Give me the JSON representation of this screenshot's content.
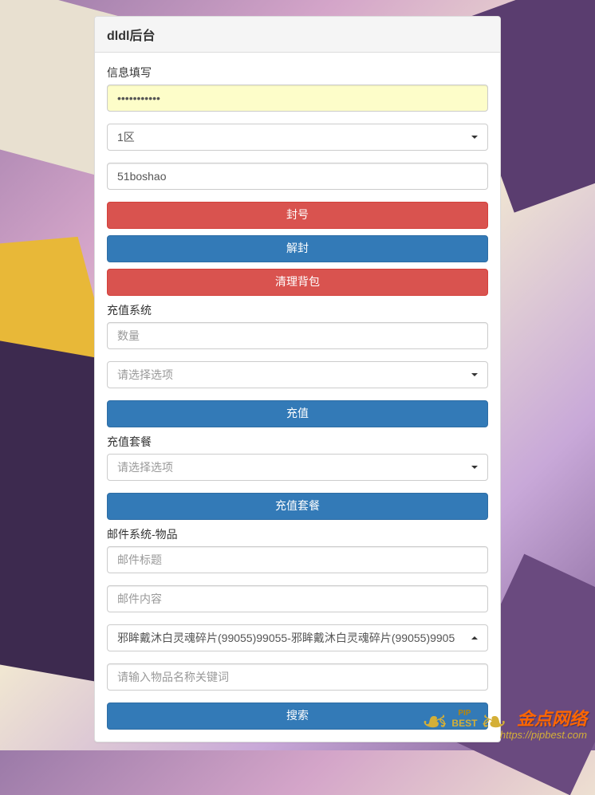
{
  "panel": {
    "title": "dldl后台"
  },
  "info_section": {
    "label": "信息填写",
    "password_value": "•••••••••••",
    "region_select": "1区",
    "username_value": "51boshao"
  },
  "action_buttons": {
    "ban": "封号",
    "unban": "解封",
    "clear_bag": "清理背包"
  },
  "recharge": {
    "label": "充值系统",
    "quantity_placeholder": "数量",
    "option_placeholder": "请选择选项",
    "button": "充值"
  },
  "package": {
    "label": "充值套餐",
    "option_placeholder": "请选择选项",
    "button": "充值套餐"
  },
  "mail": {
    "label": "邮件系统-物品",
    "title_placeholder": "邮件标题",
    "content_placeholder": "邮件内容",
    "item_select": "邪眸戴沐白灵魂碎片(99055)99055-邪眸戴沐白灵魂碎片(99055)9905",
    "search_placeholder": "请输入物品名称关键词",
    "search_button": "搜索"
  },
  "watermark": {
    "logo_top": "PIP",
    "logo_bottom": "BEST",
    "brand_cn": "金点网络",
    "url": "https://pipbest.com"
  }
}
